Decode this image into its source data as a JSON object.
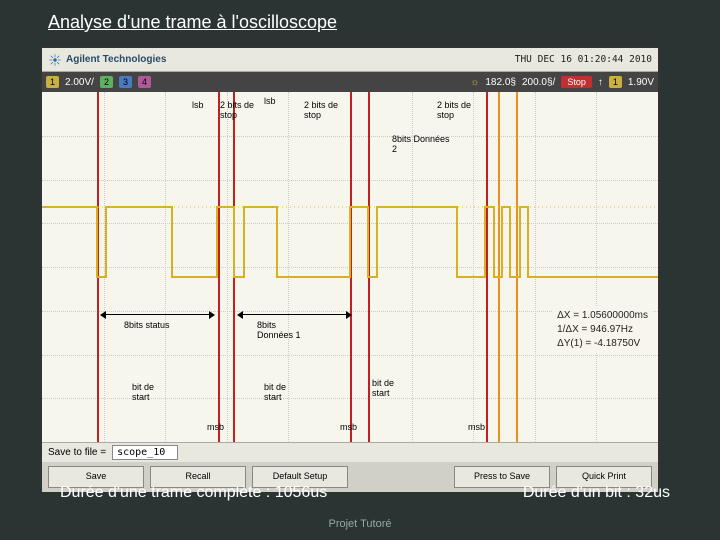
{
  "slide": {
    "title": "Analyse d'une trame à l'oscilloscope",
    "caption_left": "Durée d'une trame complète : 1056us",
    "caption_right": "Durée d'un bit : 32us",
    "footer": "Projet Tutoré"
  },
  "scope": {
    "brand": "Agilent Technologies",
    "timestamp": "THU DEC 16 01:20:44 2010",
    "channels": {
      "ch1": {
        "label": "1",
        "value": "2.00V/"
      },
      "ch2": {
        "label": "2"
      },
      "ch3": {
        "label": "3"
      },
      "ch4": {
        "label": "4"
      }
    },
    "timebase": "182.0§",
    "timediv": "200.0§/",
    "status": "Stop",
    "trigger": {
      "edge": "↑",
      "ch": "1",
      "level": "1.90V"
    },
    "save_label": "Save to file =",
    "save_file": "scope_10",
    "softkeys": [
      "Save",
      "Recall",
      "Default Setup",
      "",
      "Press to Save",
      "Quick Print"
    ],
    "measurements": {
      "dx": "ΔX = 1.05600000ms",
      "inv_dx": "1/ΔX = 946.97Hz",
      "dy": "ΔY(1) = -4.18750V"
    },
    "annotations": {
      "lsb1": "lsb",
      "lsb2": "lsb",
      "two_bits_stop1": "2 bits de stop",
      "two_bits_stop2": "2 bits de stop",
      "two_bits_stop3": "2 bits de stop",
      "eight_bits_data2": "8bits Données 2",
      "eight_bits_status": "8bits status",
      "eight_bits_data1": "8bits Données 1",
      "bit_start1": "bit de start",
      "bit_start2": "bit de start",
      "bit_start3": "bit de start",
      "msb1": "msb",
      "msb2": "msb",
      "msb3": "msb"
    }
  }
}
